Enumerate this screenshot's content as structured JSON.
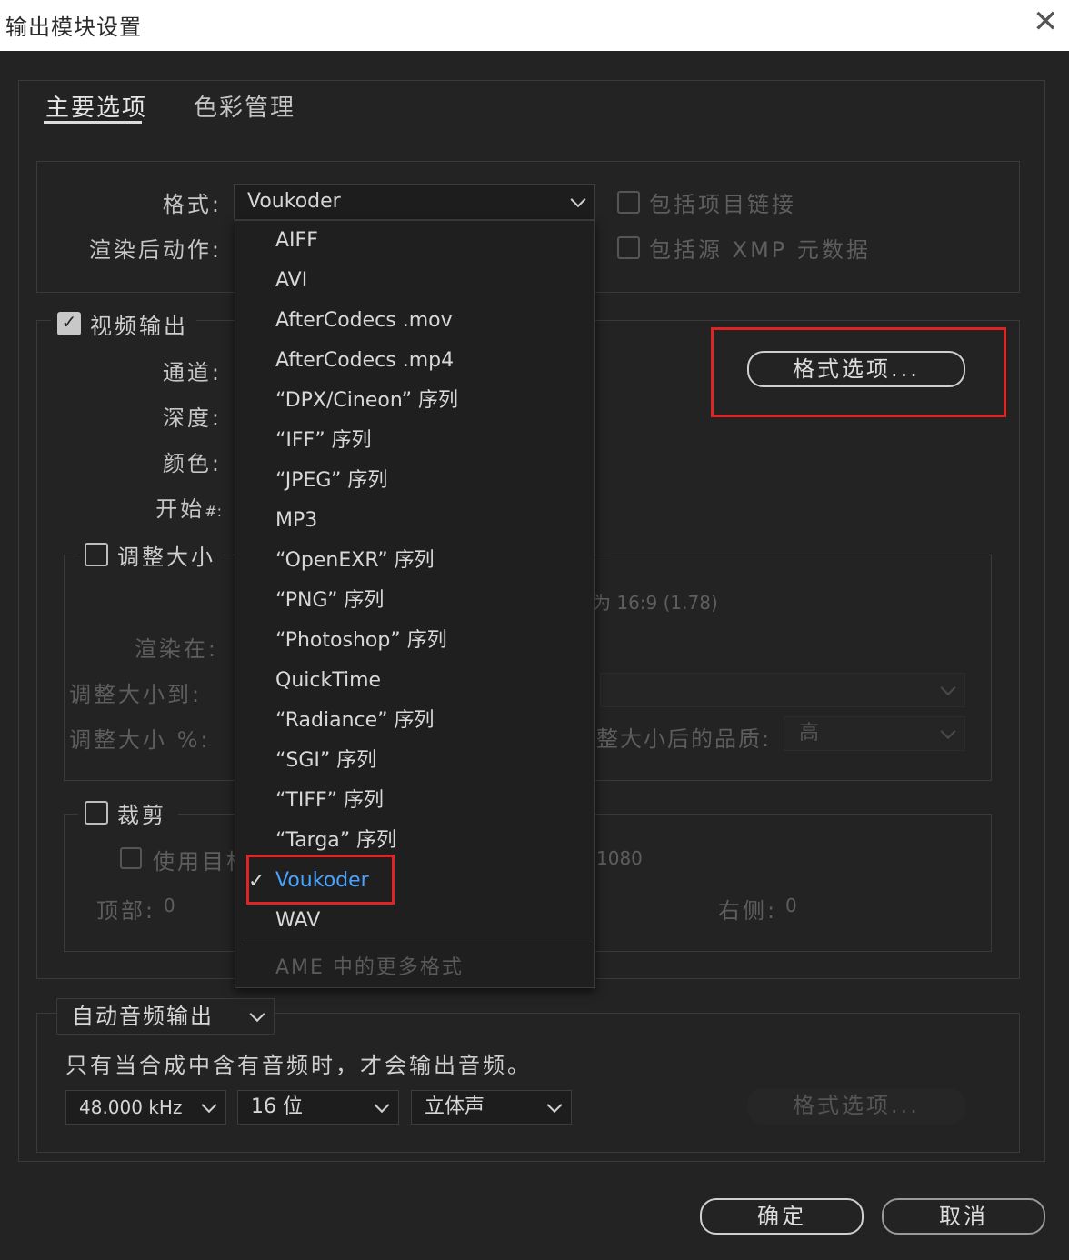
{
  "window": {
    "title": "输出模块设置",
    "close_glyph": "✕"
  },
  "tabs": [
    {
      "label": "主要选项",
      "active": true
    },
    {
      "label": "色彩管理",
      "active": false
    }
  ],
  "main": {
    "format_label": "格式:",
    "format_value": "Voukoder",
    "post_render_label": "渲染后动作:",
    "include_project_link_label": "包括项目链接",
    "include_xmp_label": "包括源 XMP 元数据"
  },
  "video": {
    "output_label": "视频输出",
    "output_checked": true,
    "channels_label": "通道:",
    "depth_label": "深度:",
    "color_label": "颜色:",
    "start_label": "开始",
    "start_hash": "#:",
    "format_options_button": "格式选项...",
    "resize_label": "调整大小",
    "aspect_text": "为 16:9 (1.78)",
    "rendering_at_label": "渲染在:",
    "resize_to_label": "调整大小到:",
    "resize_percent_label": "调整大小 %:",
    "resize_quality_label": "调整大小后的品质:",
    "resize_quality_value": "高",
    "crop_label": "裁剪",
    "use_region_label": "使用目标",
    "crop_dim_value": "1080",
    "top_label": "顶部:",
    "top_value": "0",
    "right_label": "右侧:",
    "right_value": "0"
  },
  "format_menu": {
    "items": [
      "AIFF",
      "AVI",
      "AfterCodecs .mov",
      "AfterCodecs .mp4",
      "“DPX/Cineon” 序列",
      "“IFF” 序列",
      "“JPEG” 序列",
      "MP3",
      "“OpenEXR” 序列",
      "“PNG” 序列",
      "“Photoshop” 序列",
      "QuickTime",
      "“Radiance” 序列",
      "“SGI” 序列",
      "“TIFF” 序列",
      "“Targa” 序列",
      "Voukoder",
      "WAV"
    ],
    "selected": "Voukoder",
    "check_glyph": "✓",
    "more_formats": "AME 中的更多格式"
  },
  "audio": {
    "mode": "自动音频输出",
    "note": "只有当合成中含有音频时，才会输出音频。",
    "sample_rate": "48.000 kHz",
    "bit_depth": "16 位",
    "channels": "立体声",
    "format_options_button": "格式选项..."
  },
  "footer": {
    "ok": "确定",
    "cancel": "取消"
  },
  "colors": {
    "highlight_red": "#e02424",
    "selected_blue": "#4aa3ff",
    "background": "#232323"
  }
}
